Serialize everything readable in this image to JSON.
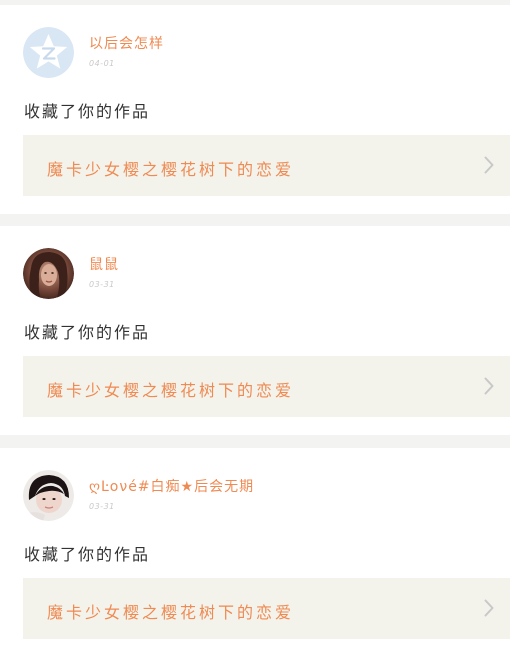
{
  "feed": {
    "items": [
      {
        "username": "以后会怎样",
        "date": "04-01",
        "action": "收藏了你的作品",
        "work_title": "魔卡少女樱之樱花树下的恋爱",
        "avatar": "qzone-default-avatar"
      },
      {
        "username": "鼠鼠",
        "date": "03-31",
        "action": "收藏了你的作品",
        "work_title": "魔卡少女樱之樱花树下的恋爱",
        "avatar": "user-photo-avatar"
      },
      {
        "username": "ღĿoνé#白痴★后会无期",
        "date": "03-31",
        "action": "收藏了你的作品",
        "work_title": "魔卡少女樱之樱花树下的恋爱",
        "avatar": "user-photo-avatar"
      }
    ]
  },
  "colors": {
    "accent": "#ef8a52",
    "page_bg": "#f3f3f1",
    "card_bg": "#ffffff",
    "link_bg": "#f3f3ec",
    "chevron": "#c8c8c8"
  }
}
